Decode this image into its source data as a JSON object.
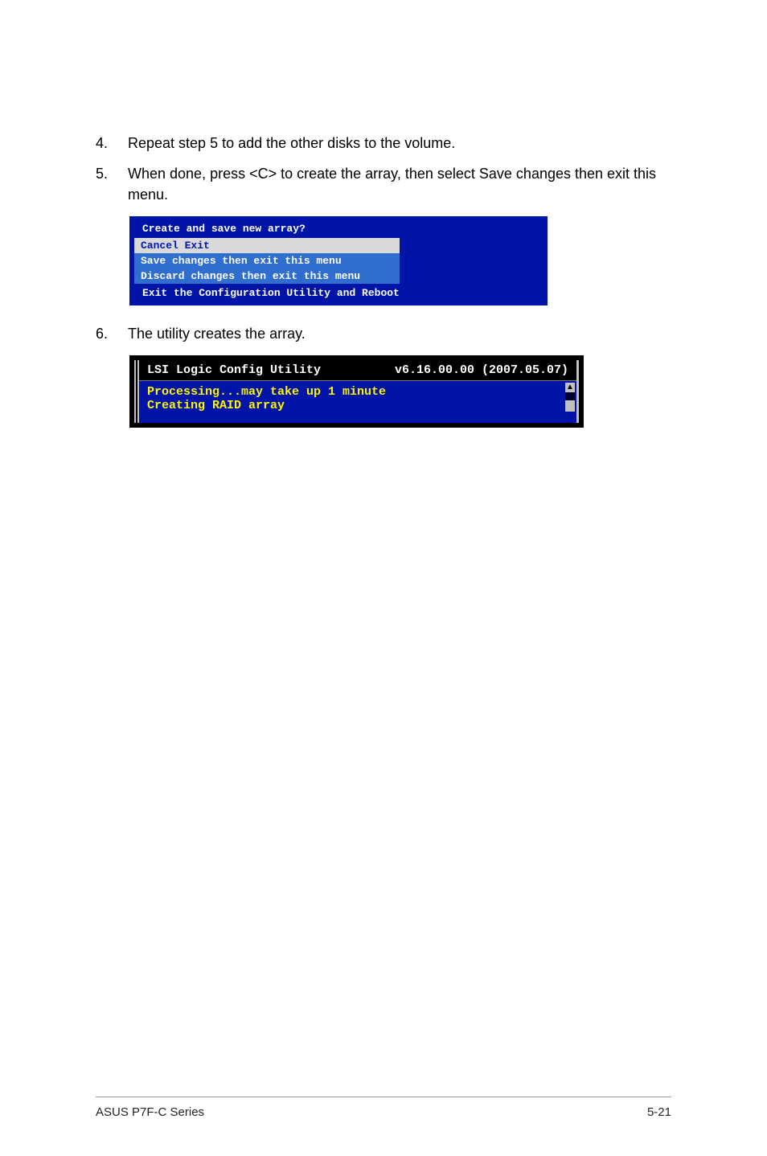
{
  "steps": {
    "s4": {
      "num": "4.",
      "text": "Repeat step 5 to add the other disks to the volume."
    },
    "s5": {
      "num": "5.",
      "text": "When done, press <C> to create the array, then select Save changes then exit this menu."
    },
    "s6": {
      "num": "6.",
      "text": "The utility creates the array."
    }
  },
  "menu": {
    "title": "Create and save new array?",
    "items": {
      "cancel": "Cancel Exit",
      "save": "Save changes then exit this menu",
      "discard": "Discard changes then exit this menu"
    },
    "footer": "Exit the Configuration Utility and Reboot"
  },
  "terminal": {
    "header_left": "LSI Logic Config Utility",
    "header_right": "v6.16.00.00 (2007.05.07)",
    "line1": "Processing...may take up 1 minute",
    "line2": "Creating RAID array"
  },
  "footer": {
    "left": "ASUS P7F-C Series",
    "right": "5-21"
  }
}
